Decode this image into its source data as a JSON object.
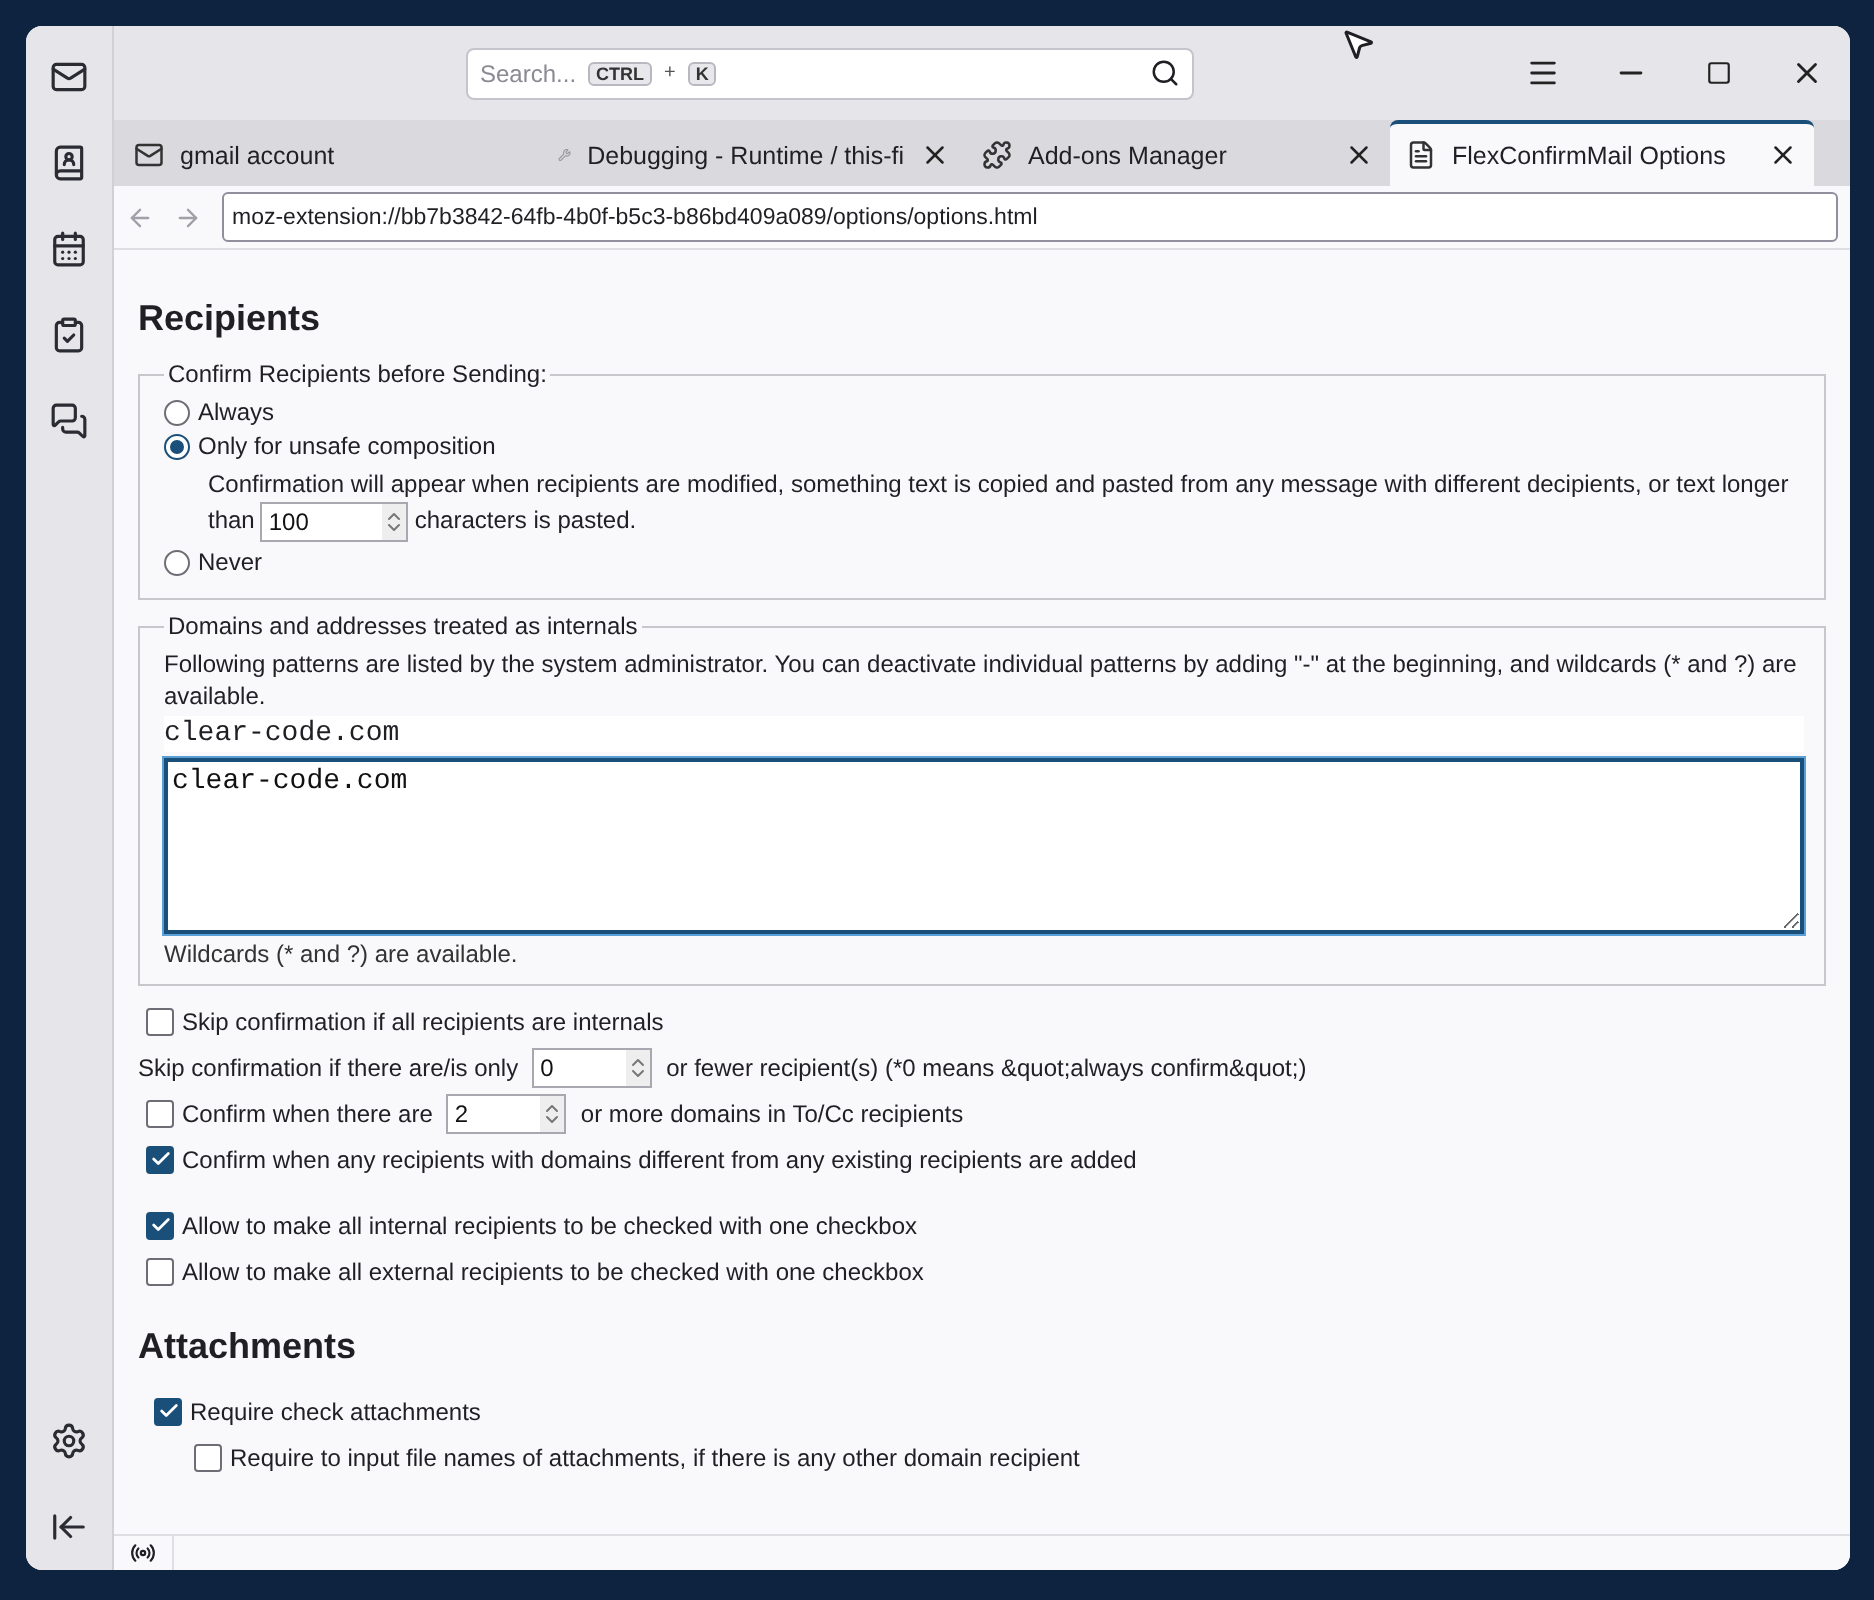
{
  "titlebar": {
    "search": {
      "placeholder": "Search...",
      "keys": [
        "CTRL",
        "K"
      ],
      "joiner": "+"
    }
  },
  "tabs": [
    {
      "label": "gmail account",
      "selected": false,
      "closable": false
    },
    {
      "label": "Debugging - Runtime / this-fi",
      "selected": false,
      "closable": true
    },
    {
      "label": "Add-ons Manager",
      "selected": false,
      "closable": true
    },
    {
      "label": "FlexConfirmMail Options",
      "selected": true,
      "closable": true
    }
  ],
  "address_bar": {
    "url": "moz-extension://bb7b3842-64fb-4b0f-b5c3-b86bd409a089/options/options.html"
  },
  "recipients": {
    "heading": "Recipients",
    "confirm_group": {
      "legend": "Confirm Recipients before Sending:",
      "radios": [
        {
          "label": "Always",
          "selected": false
        },
        {
          "label": "Only for unsafe composition",
          "selected": true,
          "detail": "Confirmation will appear when recipients are modified, something text is copied and pasted from any message with different decipients, or text longer",
          "detail_before": "than",
          "number": "100",
          "detail_after": "characters is pasted."
        },
        {
          "label": "Never",
          "selected": false
        }
      ]
    },
    "internals_group": {
      "legend": "Domains and addresses treated as internals",
      "description": "Following patterns are listed by the system administrator. You can deactivate individual patterns by adding \"-\" at the beginning, and wildcards (* and ?) are available.",
      "fixed_patterns": [
        "clear-code.com"
      ],
      "textarea_value": "clear-code.com",
      "hint": "Wildcards (* and ?) are available."
    },
    "option_groups": [
      [
        {
          "kind": "checkbox",
          "checked": false,
          "label": "Skip confirmation if all recipients are internals"
        },
        {
          "kind": "number",
          "before": "Skip confirmation if there are/is only",
          "number": "0",
          "after": "or fewer recipient(s) (*0 means &quot;always confirm&quot;)"
        },
        {
          "kind": "checkbox_number",
          "checked": false,
          "before": "Confirm when there are",
          "number": "2",
          "after": "or more domains in To/Cc recipients"
        },
        {
          "kind": "checkbox",
          "checked": true,
          "label": "Confirm when any recipients with domains different from any existing recipients are added"
        }
      ],
      [
        {
          "kind": "checkbox",
          "checked": true,
          "label": "Allow to make all internal recipients to be checked with one checkbox"
        },
        {
          "kind": "checkbox",
          "checked": false,
          "label": "Allow to make all external recipients to be checked with one checkbox"
        }
      ]
    ]
  },
  "attachments": {
    "heading": "Attachments",
    "options": [
      {
        "checked": true,
        "label": "Require check attachments",
        "children": [
          {
            "checked": false,
            "label": "Require to input file names of attachments, if there is any other domain recipient"
          }
        ]
      }
    ]
  }
}
